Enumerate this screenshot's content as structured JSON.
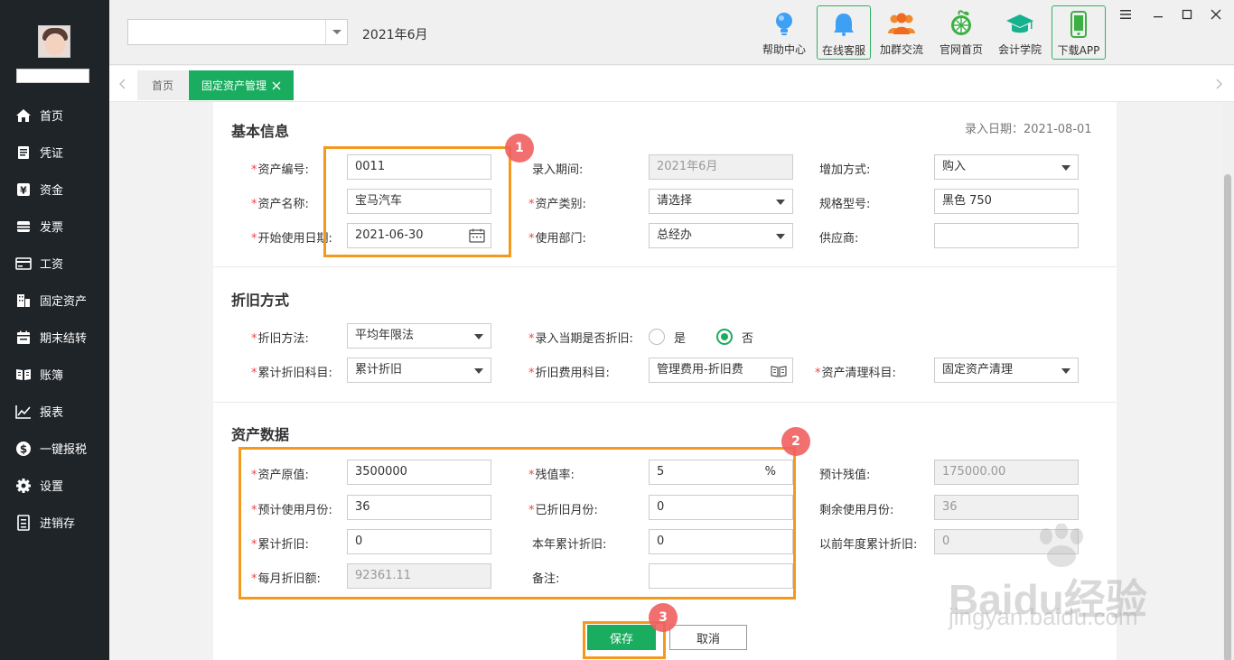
{
  "topbar": {
    "period": "2021年6月",
    "tools": [
      "帮助中心",
      "在线客服",
      "加群交流",
      "官网首页",
      "会计学院",
      "下载APP"
    ]
  },
  "sidebar": {
    "items": [
      "首页",
      "凭证",
      "资金",
      "发票",
      "工资",
      "固定资产",
      "期末结转",
      "账簿",
      "报表",
      "一键报税",
      "设置",
      "进销存"
    ]
  },
  "tabs": {
    "home": "首页",
    "active": "固定资产管理"
  },
  "basic": {
    "title": "基本信息",
    "entry_date": "录入日期：2021-08-01",
    "asset_no_label": "资产编号:",
    "asset_no": "0011",
    "asset_name_label": "资产名称:",
    "asset_name": "宝马汽车",
    "start_date_label": "开始使用日期:",
    "start_date": "2021-06-30",
    "entry_period_label": "录入期间:",
    "entry_period": "2021年6月",
    "category_label": "资产类别:",
    "category": "请选择",
    "dept_label": "使用部门:",
    "dept": "总经办",
    "add_method_label": "增加方式:",
    "add_method": "购入",
    "spec_label": "规格型号:",
    "spec": "黑色 750",
    "supplier_label": "供应商:",
    "supplier": ""
  },
  "depr": {
    "title": "折旧方式",
    "method_label": "折旧方法:",
    "method": "平均年限法",
    "current_label": "录入当期是否折旧:",
    "yes": "是",
    "no": "否",
    "accum_subject_label": "累计折旧科目:",
    "accum_subject": "累计折旧",
    "expense_subject_label": "折旧费用科目:",
    "expense_subject": "管理费用-折旧费",
    "clear_subject_label": "资产清理科目:",
    "clear_subject": "固定资产清理"
  },
  "asset": {
    "title": "资产数据",
    "orig_label": "资产原值:",
    "orig": "3500000",
    "residual_rate_label": "残值率:",
    "residual_rate": "5",
    "pct": "%",
    "est_residual_label": "预计残值:",
    "est_residual": "175000.00",
    "months_label": "预计使用月份:",
    "months": "36",
    "used_months_label": "已折旧月份:",
    "used_months": "0",
    "remain_months_label": "剩余使用月份:",
    "remain_months": "36",
    "accum_label": "累计折旧:",
    "accum": "0",
    "year_accum_label": "本年累计折旧:",
    "year_accum": "0",
    "prev_accum_label": "以前年度累计折旧:",
    "prev_accum": "0",
    "monthly_label": "每月折旧额:",
    "monthly": "92361.11",
    "note_label": "备注:",
    "note": ""
  },
  "buttons": {
    "save": "保存",
    "cancel": "取消"
  },
  "badges": [
    "1",
    "2",
    "3"
  ],
  "watermark": {
    "brand": "Baidu经验",
    "url": "jingyan.baidu.com"
  }
}
